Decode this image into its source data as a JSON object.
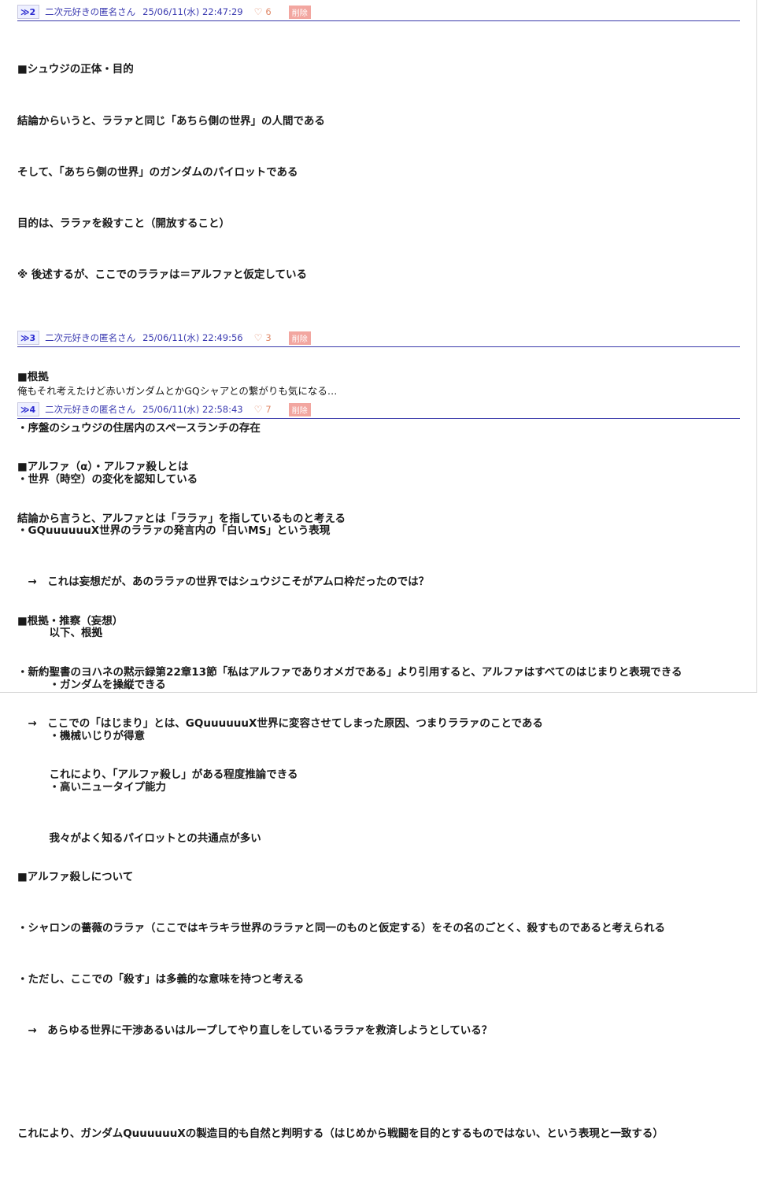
{
  "posts": [
    {
      "number": "≫2",
      "name": "二次元好きの匿名さん",
      "date": "25/06/11(水) 22:47:29",
      "likes": "6",
      "delete_label": "削除",
      "lines": [
        "■シュウジの正体・目的",
        "結論からいうと、ララァと同じ「あちら側の世界」の人間である",
        "そして、「あちら側の世界」のガンダムのパイロットである",
        "目的は、ララァを殺すこと（開放すること）",
        "※ 後述するが、ここでのララァは＝アルファと仮定している",
        "",
        "■根拠",
        "・序盤のシュウジの住居内のスペースランチの存在",
        "・世界（時空）の変化を認知している",
        "・GQuuuuuuX世界のララァの発言内の「白いMS」という表現",
        "　→　これは妄想だが、あのララァの世界ではシュウジこそがアムロ枠だったのでは？",
        "　　　以下、根拠",
        "　　　・ガンダムを操縦できる",
        "　　　・機械いじりが得意",
        "　　　・高いニュータイプ能力",
        "　　　我々がよく知るパイロットとの共通点が多い"
      ]
    },
    {
      "number": "≫3",
      "name": "二次元好きの匿名さん",
      "date": "25/06/11(水) 22:49:56",
      "likes": "3",
      "delete_label": "削除",
      "lines": [
        "俺もそれ考えたけど赤いガンダムとかGQシャアとの繋がりも気になる…"
      ]
    },
    {
      "number": "≫4",
      "name": "二次元好きの匿名さん",
      "date": "25/06/11(水) 22:58:43",
      "likes": "7",
      "delete_label": "削除",
      "lines": [
        "■アルファ（α）・アルファ殺しとは",
        "結論から言うと、アルファとは「ララァ」を指しているものと考える",
        "",
        "■根拠・推察（妄想）",
        "・新約聖書のヨハネの黙示録第22章13節「私はアルファでありオメガである」より引用すると、アルファはすべてのはじまりと表現できる",
        "　→　ここでの「はじまり」とは、GQuuuuuuX世界に変容させてしまった原因、つまりララァのことである",
        "　　　これにより、「アルファ殺し」がある程度推論できる",
        "",
        "■アルファ殺しについて",
        "・シャロンの薔薇のララァ（ここではキラキラ世界のララァと同一のものと仮定する）をその名のごとく、殺すものであると考えられる",
        "・ただし、ここでの「殺す」は多義的な意味を持つと考える",
        "　→　あらゆる世界に干渉あるいはループしてやり直しをしているララァを救済しようとしている？",
        "",
        "これにより、ガンダムQuuuuuuXの製造目的も自然と判明する（はじめから戦闘を目的とするものではない、という表現と一致する）"
      ]
    }
  ]
}
